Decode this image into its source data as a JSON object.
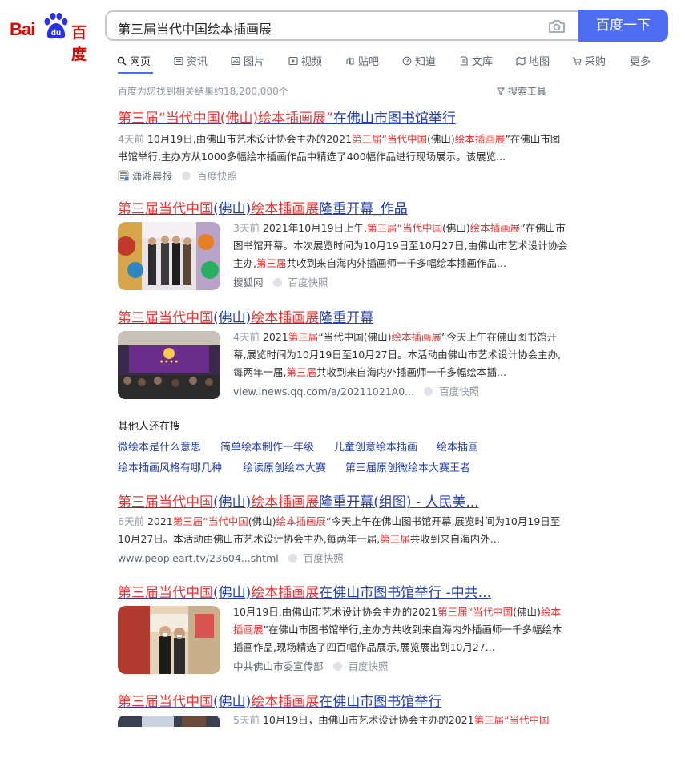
{
  "logo": {
    "latin": "Bai",
    "paw_text": "du",
    "chinese": "百度"
  },
  "search": {
    "query": "第三届当代中国绘本插画展",
    "button": "百度一下"
  },
  "tabs": [
    {
      "label": "网页",
      "icon": "search-icon"
    },
    {
      "label": "资讯",
      "icon": "news-icon"
    },
    {
      "label": "图片",
      "icon": "image-icon"
    },
    {
      "label": "视频",
      "icon": "video-icon"
    },
    {
      "label": "贴吧",
      "icon": "tieba-icon"
    },
    {
      "label": "知道",
      "icon": "question-icon"
    },
    {
      "label": "文库",
      "icon": "doc-icon"
    },
    {
      "label": "地图",
      "icon": "map-icon"
    },
    {
      "label": "采购",
      "icon": "cart-icon"
    },
    {
      "label": "更多",
      "icon": ""
    }
  ],
  "stats": {
    "count": "百度为您找到相关结果约18,200,000个",
    "tools": "搜索工具"
  },
  "results": [
    {
      "title": [
        [
          "第三届“当代中国(佛山)绘本插画展”",
          true
        ],
        [
          "在佛山市图书馆举行",
          false
        ]
      ],
      "time": "4天前",
      "abstract": [
        [
          "10月19日,由佛山市艺术设计协会主办的2021",
          false
        ],
        [
          "第三届“当代中国",
          true
        ],
        [
          "(佛山)",
          false
        ],
        [
          "绘本插画展",
          true
        ],
        [
          "”在佛山市图书馆举行,主办方从1000多幅绘本插画作品中精选了400幅作品进行现场展示。该展览...",
          false
        ]
      ],
      "source": "潇湘晨报",
      "snapshot": "百度快照"
    },
    {
      "title": [
        [
          "第三届当代中国",
          true
        ],
        [
          "(佛山)",
          false
        ],
        [
          "绘本插画展",
          true
        ],
        [
          "隆重开幕_作品",
          false
        ]
      ],
      "time": "3天前",
      "abstract": [
        [
          "2021年10月19日上午,",
          false
        ],
        [
          "第三届“当代中国",
          true
        ],
        [
          "(佛山)",
          false
        ],
        [
          "绘本插画展",
          true
        ],
        [
          "”在佛山市图书馆开幕。本次展览时间为10月19日至10月27日,由佛山市艺术设计协会主办,",
          false
        ],
        [
          "第三届",
          true
        ],
        [
          "共收到来自海内外插画师一千多幅绘本插画作品...",
          false
        ]
      ],
      "source": "搜狐网",
      "snapshot": "百度快照"
    },
    {
      "title": [
        [
          "第三届当代中国",
          true
        ],
        [
          "(佛山)",
          false
        ],
        [
          "绘本插画展",
          true
        ],
        [
          "隆重开幕",
          false
        ]
      ],
      "time": "4天前",
      "abstract": [
        [
          "2021",
          false
        ],
        [
          "第三届",
          true
        ],
        [
          "“当代中国(佛山)",
          false
        ],
        [
          "绘本插画展",
          true
        ],
        [
          "”今天上午在佛山图书馆开幕,展览时间为10月19日至10月27日。本活动由佛山市艺术设计协会主办,每两年一届,",
          false
        ],
        [
          "第三届",
          true
        ],
        [
          "共收到来自海内外插画师一千多幅绘本插...",
          false
        ]
      ],
      "source": "view.inews.qq.com/a/20211021A0...",
      "snapshot": "百度快照"
    },
    {
      "title": [
        [
          "第三届当代中国",
          true
        ],
        [
          "(佛山)",
          false
        ],
        [
          "绘本插画展",
          true
        ],
        [
          "隆重开幕(组图) - 人民美...",
          false
        ]
      ],
      "time": "6天前",
      "abstract": [
        [
          "2021",
          false
        ],
        [
          "第三届“当代中国",
          true
        ],
        [
          "(佛山)",
          false
        ],
        [
          "绘本插画展",
          true
        ],
        [
          "”今天上午在佛山图书馆开幕,展览时间为10月19日至10月27日。本活动由佛山市艺术设计协会主办,每两年一届,",
          false
        ],
        [
          "第三届",
          true
        ],
        [
          "共收到来自海内外...",
          false
        ]
      ],
      "source": "www.peopleart.tv/23604...shtml",
      "snapshot": "百度快照"
    },
    {
      "title": [
        [
          "第三届当代中国",
          true
        ],
        [
          "(佛山)",
          false
        ],
        [
          "绘本插画展",
          true
        ],
        [
          "在佛山市图书馆举行 -中共...",
          false
        ]
      ],
      "time": "",
      "abstract": [
        [
          "10月19日,由佛山市艺术设计协会主办的2021",
          false
        ],
        [
          "第三届“当代中国",
          true
        ],
        [
          "(佛山)",
          false
        ],
        [
          "绘本插画展",
          true
        ],
        [
          "”在佛山市图书馆举行,主办方共收到来自海内外插画师一千多幅绘本插画作品,现场精选了四百幅作品展示,展览展出到10月27...",
          false
        ]
      ],
      "source": "中共佛山市委宣传部",
      "snapshot": "百度快照"
    },
    {
      "title": [
        [
          "第三届当代中国",
          true
        ],
        [
          "(佛山)",
          false
        ],
        [
          "绘本插画展",
          true
        ],
        [
          "在佛山市图书馆举行",
          false
        ]
      ],
      "time": "5天前",
      "abstract": [
        [
          "10月19日，由佛山市艺术设计协会主办的2021",
          false
        ],
        [
          "第三届“当代中国",
          true
        ]
      ],
      "source": "",
      "snapshot": ""
    }
  ],
  "others": {
    "title": "其他人还在搜",
    "items": [
      "微绘本是什么意思",
      "简单绘本制作一年级",
      "儿童创意绘本插画",
      "绘本插画",
      "绘本插画风格有哪几种",
      "绘读原创绘本大赛",
      "第三届原创微绘本大赛王者"
    ]
  },
  "colors": {
    "brand_red": "#e10602",
    "button_blue": "#4e6ef2",
    "link_blue": "#2440b3",
    "highlight_red": "#f73131"
  }
}
